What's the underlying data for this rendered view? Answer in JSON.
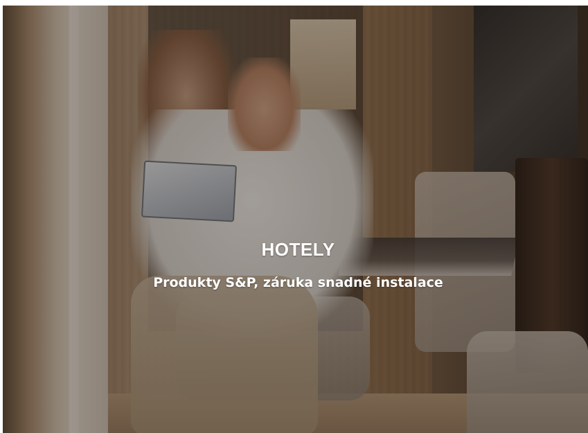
{
  "hero": {
    "image_description_icon": "hotel-couple-photo",
    "title": "HOTELY",
    "subtitle": "Produkty S&P, záruka snadné instalace",
    "overlay_color": "#19120c",
    "text_color": "#ffffff"
  }
}
